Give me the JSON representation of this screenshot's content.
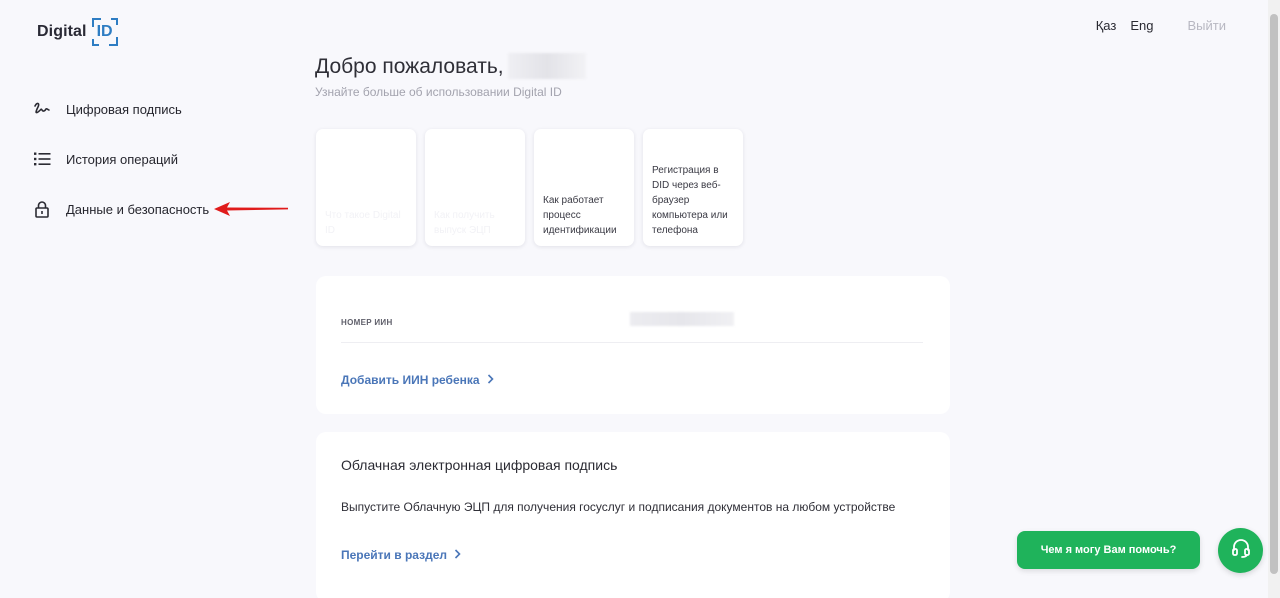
{
  "header": {
    "logo_text": "Digital",
    "logo_id": "ID",
    "lang_kz": "Қаз",
    "lang_en": "Eng",
    "logout": "Выйти"
  },
  "sidebar": {
    "items": [
      {
        "label": "Цифровая подпись",
        "icon": "signature-icon"
      },
      {
        "label": "История операций",
        "icon": "list-icon"
      },
      {
        "label": "Данные и безопасность",
        "icon": "lock-icon"
      }
    ]
  },
  "main": {
    "welcome": "Добро пожаловать,",
    "subtitle": "Узнайте больше об использовании Digital ID",
    "tiles": [
      {
        "label": "Что такое Digital ID"
      },
      {
        "label": "Как получить выпуск ЭЦП"
      },
      {
        "label": "Как работает процесс идентификации"
      },
      {
        "label": "Регистрация в DID через веб-браузер компьютера или телефона"
      }
    ],
    "iin_card": {
      "label": "НОМЕР ИИН",
      "add_child": "Добавить ИИН ребенка"
    },
    "cloud_card": {
      "title": "Облачная электронная цифровая подпись",
      "description": "Выпустите Облачную ЭЦП для получения госуслуг и подписания документов на любом устройстве",
      "link": "Перейти в раздел"
    }
  },
  "help": {
    "text": "Чем я могу Вам помочь?"
  },
  "colors": {
    "accent_blue": "#4a76b8",
    "logo_blue": "#2e7dc3",
    "help_green": "#1fb35b",
    "annotation_red": "#e01b1b"
  }
}
